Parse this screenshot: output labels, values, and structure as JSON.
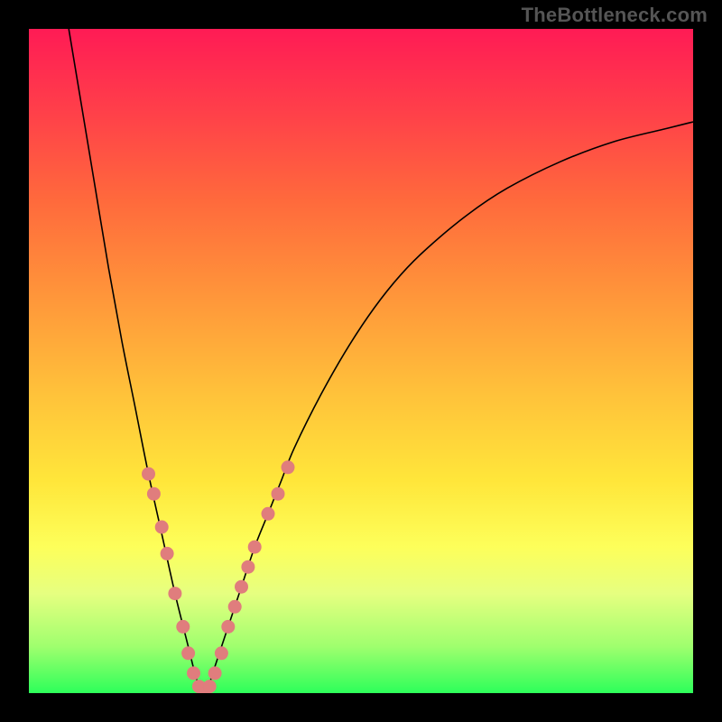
{
  "attribution": "TheBottleneck.com",
  "chart_data": {
    "type": "line",
    "title": "",
    "xlabel": "",
    "ylabel": "",
    "xlim": [
      0,
      100
    ],
    "ylim": [
      0,
      100
    ],
    "curve": {
      "name": "bottleneck-curve",
      "minimum_x": 26,
      "x": [
        6,
        8,
        10,
        12,
        14,
        16,
        18,
        20,
        22,
        24,
        25,
        26,
        27,
        28,
        30,
        32,
        34,
        36,
        38,
        40,
        44,
        48,
        52,
        56,
        60,
        66,
        72,
        80,
        88,
        96,
        100
      ],
      "y": [
        100,
        88,
        76,
        64,
        53,
        43,
        33,
        24,
        15,
        7,
        3,
        0,
        1,
        4,
        10,
        16,
        22,
        27,
        32,
        37,
        45,
        52,
        58,
        63,
        67,
        72,
        76,
        80,
        83,
        85,
        86
      ]
    },
    "markers": {
      "name": "highlight-points",
      "points": [
        {
          "x": 18.0,
          "y": 33
        },
        {
          "x": 18.8,
          "y": 30
        },
        {
          "x": 20.0,
          "y": 25
        },
        {
          "x": 20.8,
          "y": 21
        },
        {
          "x": 22.0,
          "y": 15
        },
        {
          "x": 23.2,
          "y": 10
        },
        {
          "x": 24.0,
          "y": 6
        },
        {
          "x": 24.8,
          "y": 3
        },
        {
          "x": 25.6,
          "y": 1
        },
        {
          "x": 26.4,
          "y": 0
        },
        {
          "x": 27.2,
          "y": 1
        },
        {
          "x": 28.0,
          "y": 3
        },
        {
          "x": 29.0,
          "y": 6
        },
        {
          "x": 30.0,
          "y": 10
        },
        {
          "x": 31.0,
          "y": 13
        },
        {
          "x": 32.0,
          "y": 16
        },
        {
          "x": 33.0,
          "y": 19
        },
        {
          "x": 34.0,
          "y": 22
        },
        {
          "x": 36.0,
          "y": 27
        },
        {
          "x": 37.5,
          "y": 30
        },
        {
          "x": 39.0,
          "y": 34
        }
      ]
    }
  }
}
